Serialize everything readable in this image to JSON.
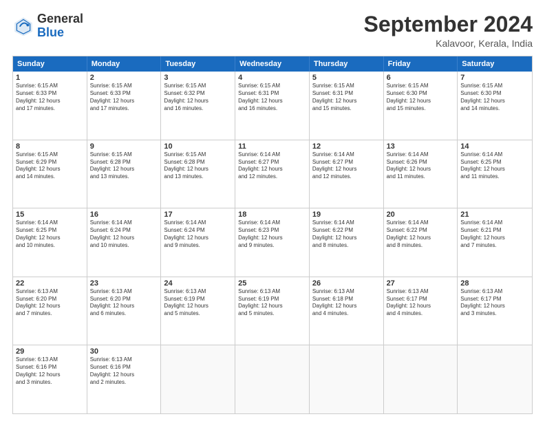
{
  "header": {
    "logo_general": "General",
    "logo_blue": "Blue",
    "month_title": "September 2024",
    "subtitle": "Kalavoor, Kerala, India"
  },
  "weekdays": [
    "Sunday",
    "Monday",
    "Tuesday",
    "Wednesday",
    "Thursday",
    "Friday",
    "Saturday"
  ],
  "rows": [
    [
      {
        "day": "1",
        "lines": [
          "Sunrise: 6:15 AM",
          "Sunset: 6:33 PM",
          "Daylight: 12 hours",
          "and 17 minutes."
        ]
      },
      {
        "day": "2",
        "lines": [
          "Sunrise: 6:15 AM",
          "Sunset: 6:33 PM",
          "Daylight: 12 hours",
          "and 17 minutes."
        ]
      },
      {
        "day": "3",
        "lines": [
          "Sunrise: 6:15 AM",
          "Sunset: 6:32 PM",
          "Daylight: 12 hours",
          "and 16 minutes."
        ]
      },
      {
        "day": "4",
        "lines": [
          "Sunrise: 6:15 AM",
          "Sunset: 6:31 PM",
          "Daylight: 12 hours",
          "and 16 minutes."
        ]
      },
      {
        "day": "5",
        "lines": [
          "Sunrise: 6:15 AM",
          "Sunset: 6:31 PM",
          "Daylight: 12 hours",
          "and 15 minutes."
        ]
      },
      {
        "day": "6",
        "lines": [
          "Sunrise: 6:15 AM",
          "Sunset: 6:30 PM",
          "Daylight: 12 hours",
          "and 15 minutes."
        ]
      },
      {
        "day": "7",
        "lines": [
          "Sunrise: 6:15 AM",
          "Sunset: 6:30 PM",
          "Daylight: 12 hours",
          "and 14 minutes."
        ]
      }
    ],
    [
      {
        "day": "8",
        "lines": [
          "Sunrise: 6:15 AM",
          "Sunset: 6:29 PM",
          "Daylight: 12 hours",
          "and 14 minutes."
        ]
      },
      {
        "day": "9",
        "lines": [
          "Sunrise: 6:15 AM",
          "Sunset: 6:28 PM",
          "Daylight: 12 hours",
          "and 13 minutes."
        ]
      },
      {
        "day": "10",
        "lines": [
          "Sunrise: 6:15 AM",
          "Sunset: 6:28 PM",
          "Daylight: 12 hours",
          "and 13 minutes."
        ]
      },
      {
        "day": "11",
        "lines": [
          "Sunrise: 6:14 AM",
          "Sunset: 6:27 PM",
          "Daylight: 12 hours",
          "and 12 minutes."
        ]
      },
      {
        "day": "12",
        "lines": [
          "Sunrise: 6:14 AM",
          "Sunset: 6:27 PM",
          "Daylight: 12 hours",
          "and 12 minutes."
        ]
      },
      {
        "day": "13",
        "lines": [
          "Sunrise: 6:14 AM",
          "Sunset: 6:26 PM",
          "Daylight: 12 hours",
          "and 11 minutes."
        ]
      },
      {
        "day": "14",
        "lines": [
          "Sunrise: 6:14 AM",
          "Sunset: 6:25 PM",
          "Daylight: 12 hours",
          "and 11 minutes."
        ]
      }
    ],
    [
      {
        "day": "15",
        "lines": [
          "Sunrise: 6:14 AM",
          "Sunset: 6:25 PM",
          "Daylight: 12 hours",
          "and 10 minutes."
        ]
      },
      {
        "day": "16",
        "lines": [
          "Sunrise: 6:14 AM",
          "Sunset: 6:24 PM",
          "Daylight: 12 hours",
          "and 10 minutes."
        ]
      },
      {
        "day": "17",
        "lines": [
          "Sunrise: 6:14 AM",
          "Sunset: 6:24 PM",
          "Daylight: 12 hours",
          "and 9 minutes."
        ]
      },
      {
        "day": "18",
        "lines": [
          "Sunrise: 6:14 AM",
          "Sunset: 6:23 PM",
          "Daylight: 12 hours",
          "and 9 minutes."
        ]
      },
      {
        "day": "19",
        "lines": [
          "Sunrise: 6:14 AM",
          "Sunset: 6:22 PM",
          "Daylight: 12 hours",
          "and 8 minutes."
        ]
      },
      {
        "day": "20",
        "lines": [
          "Sunrise: 6:14 AM",
          "Sunset: 6:22 PM",
          "Daylight: 12 hours",
          "and 8 minutes."
        ]
      },
      {
        "day": "21",
        "lines": [
          "Sunrise: 6:14 AM",
          "Sunset: 6:21 PM",
          "Daylight: 12 hours",
          "and 7 minutes."
        ]
      }
    ],
    [
      {
        "day": "22",
        "lines": [
          "Sunrise: 6:13 AM",
          "Sunset: 6:20 PM",
          "Daylight: 12 hours",
          "and 7 minutes."
        ]
      },
      {
        "day": "23",
        "lines": [
          "Sunrise: 6:13 AM",
          "Sunset: 6:20 PM",
          "Daylight: 12 hours",
          "and 6 minutes."
        ]
      },
      {
        "day": "24",
        "lines": [
          "Sunrise: 6:13 AM",
          "Sunset: 6:19 PM",
          "Daylight: 12 hours",
          "and 5 minutes."
        ]
      },
      {
        "day": "25",
        "lines": [
          "Sunrise: 6:13 AM",
          "Sunset: 6:19 PM",
          "Daylight: 12 hours",
          "and 5 minutes."
        ]
      },
      {
        "day": "26",
        "lines": [
          "Sunrise: 6:13 AM",
          "Sunset: 6:18 PM",
          "Daylight: 12 hours",
          "and 4 minutes."
        ]
      },
      {
        "day": "27",
        "lines": [
          "Sunrise: 6:13 AM",
          "Sunset: 6:17 PM",
          "Daylight: 12 hours",
          "and 4 minutes."
        ]
      },
      {
        "day": "28",
        "lines": [
          "Sunrise: 6:13 AM",
          "Sunset: 6:17 PM",
          "Daylight: 12 hours",
          "and 3 minutes."
        ]
      }
    ],
    [
      {
        "day": "29",
        "lines": [
          "Sunrise: 6:13 AM",
          "Sunset: 6:16 PM",
          "Daylight: 12 hours",
          "and 3 minutes."
        ]
      },
      {
        "day": "30",
        "lines": [
          "Sunrise: 6:13 AM",
          "Sunset: 6:16 PM",
          "Daylight: 12 hours",
          "and 2 minutes."
        ]
      },
      {
        "day": "",
        "lines": []
      },
      {
        "day": "",
        "lines": []
      },
      {
        "day": "",
        "lines": []
      },
      {
        "day": "",
        "lines": []
      },
      {
        "day": "",
        "lines": []
      }
    ]
  ]
}
